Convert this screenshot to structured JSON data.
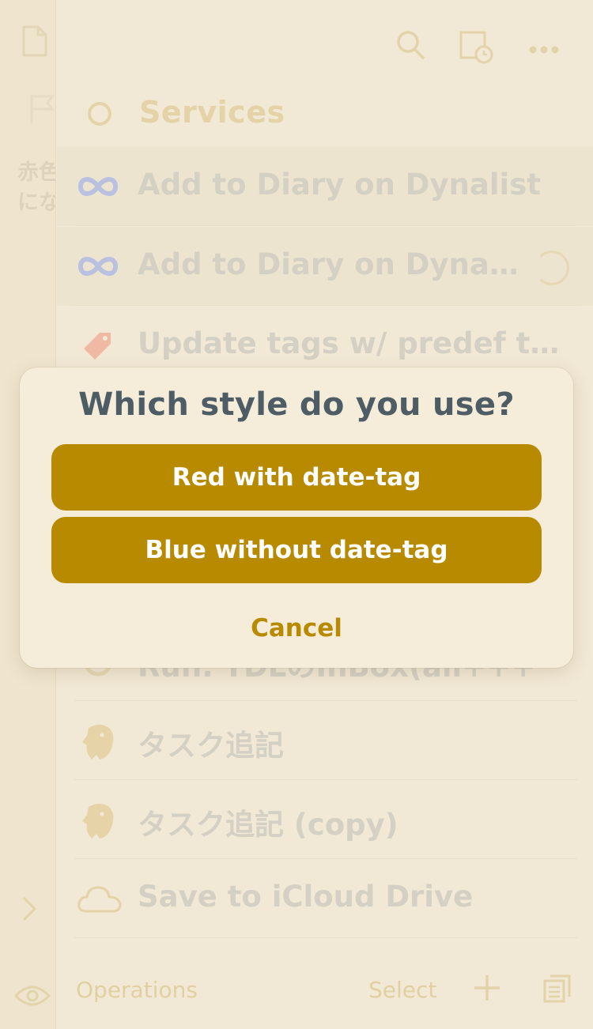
{
  "sidebar": {
    "text_line1": "赤色",
    "text_line2": "にな"
  },
  "header": {
    "section_title": "Services"
  },
  "rows": [
    {
      "label": "Add to Diary on Dynalist",
      "icon": "infinity-icon",
      "icon_color": "#b9c0e0"
    },
    {
      "label": "Add to Diary on Dynali…",
      "icon": "infinity-icon",
      "icon_color": "#b9c0e0",
      "loading": true
    },
    {
      "label": "Update tags w/ predef ta…",
      "icon": "tag-icon",
      "icon_color": "#f0b9a4"
    },
    {
      "label": "Run: TDLのInBox(all+++",
      "icon": "circle-icon",
      "icon_color": "#e6d8b4"
    },
    {
      "label": "タスク追記",
      "icon": "elephant-icon",
      "icon_color": "#e6d4a8"
    },
    {
      "label": "タスク追記 (copy)",
      "icon": "elephant-icon",
      "icon_color": "#e6d4a8"
    },
    {
      "label": "Save to iCloud Drive",
      "icon": "cloud-icon",
      "icon_color": "#e3d3a7"
    }
  ],
  "bottombar": {
    "operations_label": "Operations",
    "select_label": "Select"
  },
  "dialog": {
    "title": "Which style do you use?",
    "option1": "Red with date-tag",
    "option2": "Blue without date-tag",
    "cancel": "Cancel"
  },
  "colors": {
    "background": "#f1e8d5",
    "accent": "#b88a00",
    "dialog_title": "#4e5d65",
    "faded_text": "#d4d0c4"
  }
}
